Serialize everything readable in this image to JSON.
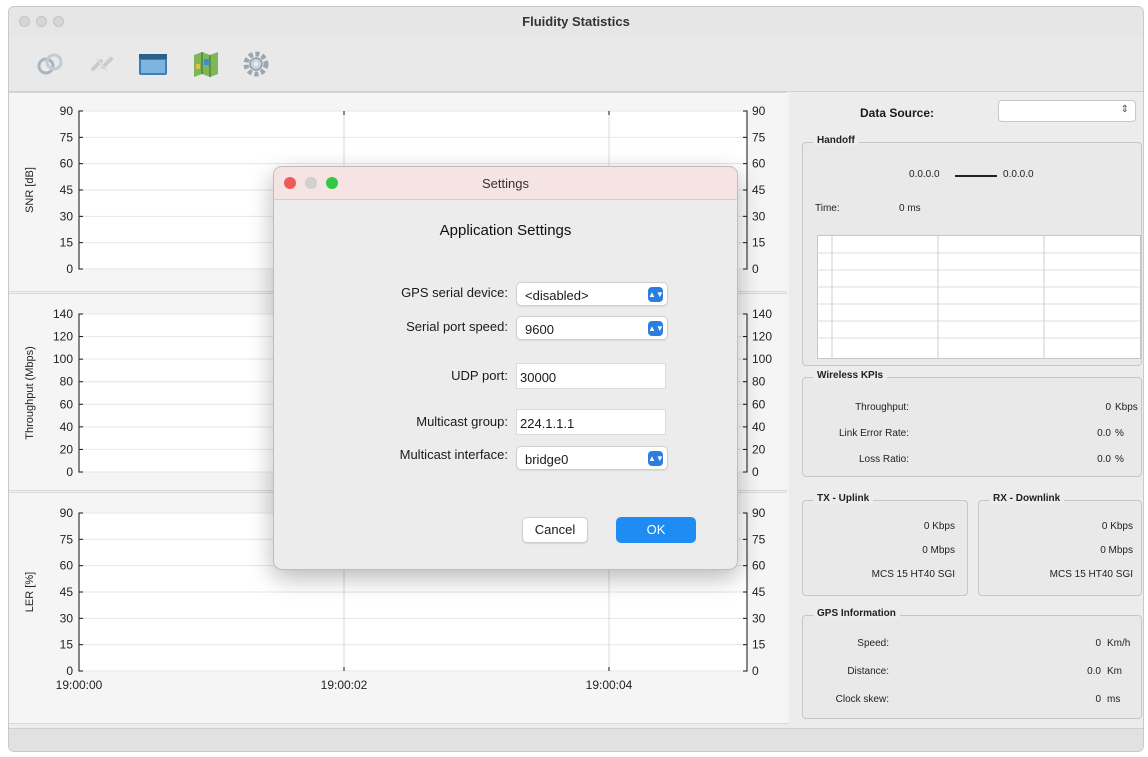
{
  "window": {
    "title": "Fluidity Statistics"
  },
  "toolbar": {
    "icons": [
      "connect-icon",
      "disconnect-icon",
      "window-icon",
      "map-icon",
      "settings-gear-icon"
    ]
  },
  "plots": {
    "snr": {
      "ylabel": "SNR [dB]",
      "ticks": [
        "90",
        "75",
        "60",
        "45",
        "30",
        "15",
        "0"
      ]
    },
    "throughput": {
      "ylabel": "Throughput (Mbps)",
      "ticks": [
        "140",
        "120",
        "100",
        "80",
        "60",
        "40",
        "20",
        "0"
      ]
    },
    "ler": {
      "ylabel": "LER [%]",
      "ticks": [
        "90",
        "75",
        "60",
        "45",
        "30",
        "15",
        "0"
      ]
    },
    "x_ticks": [
      "19:00:00",
      "19:00:02",
      "19:00:04"
    ]
  },
  "side": {
    "data_source_label": "Data Source:",
    "data_source_value": "",
    "handoff": {
      "title": "Handoff",
      "from": "0.0.0.0",
      "to": "0.0.0.0",
      "time_label": "Time:",
      "time_value": "0 ms"
    },
    "wireless": {
      "title": "Wireless KPIs",
      "rows": [
        {
          "label": "Throughput:",
          "value": "0",
          "unit": "Kbps"
        },
        {
          "label": "Link Error Rate:",
          "value": "0.0",
          "unit": "%"
        },
        {
          "label": "Loss Ratio:",
          "value": "0.0",
          "unit": "%"
        }
      ]
    },
    "tx": {
      "title": "TX - Uplink",
      "kbps": "0 Kbps",
      "mbps": "0 Mbps",
      "mcs": "MCS 15 HT40 SGI"
    },
    "rx": {
      "title": "RX - Downlink",
      "kbps": "0 Kbps",
      "mbps": "0 Mbps",
      "mcs": "MCS 15 HT40 SGI"
    },
    "gps": {
      "title": "GPS Information",
      "rows": [
        {
          "label": "Speed:",
          "value": "0",
          "unit": "Km/h"
        },
        {
          "label": "Distance:",
          "value": "0.0",
          "unit": "Km"
        },
        {
          "label": "Clock skew:",
          "value": "0",
          "unit": "ms"
        }
      ]
    }
  },
  "dialog": {
    "title": "Settings",
    "heading": "Application Settings",
    "gps_label": "GPS serial device:",
    "gps_value": "<disabled>",
    "speed_label": "Serial port speed:",
    "speed_value": "9600",
    "udp_label": "UDP port:",
    "udp_value": "30000",
    "mcast_group_label": "Multicast group:",
    "mcast_group_value": "224.1.1.1",
    "mcast_if_label": "Multicast interface:",
    "mcast_if_value": "bridge0",
    "cancel_label": "Cancel",
    "ok_label": "OK"
  },
  "colors": {
    "accent": "#1e8cf2",
    "close": "#ec5b55",
    "minimize": "#d0d0d0",
    "zoom": "#2fc945"
  }
}
